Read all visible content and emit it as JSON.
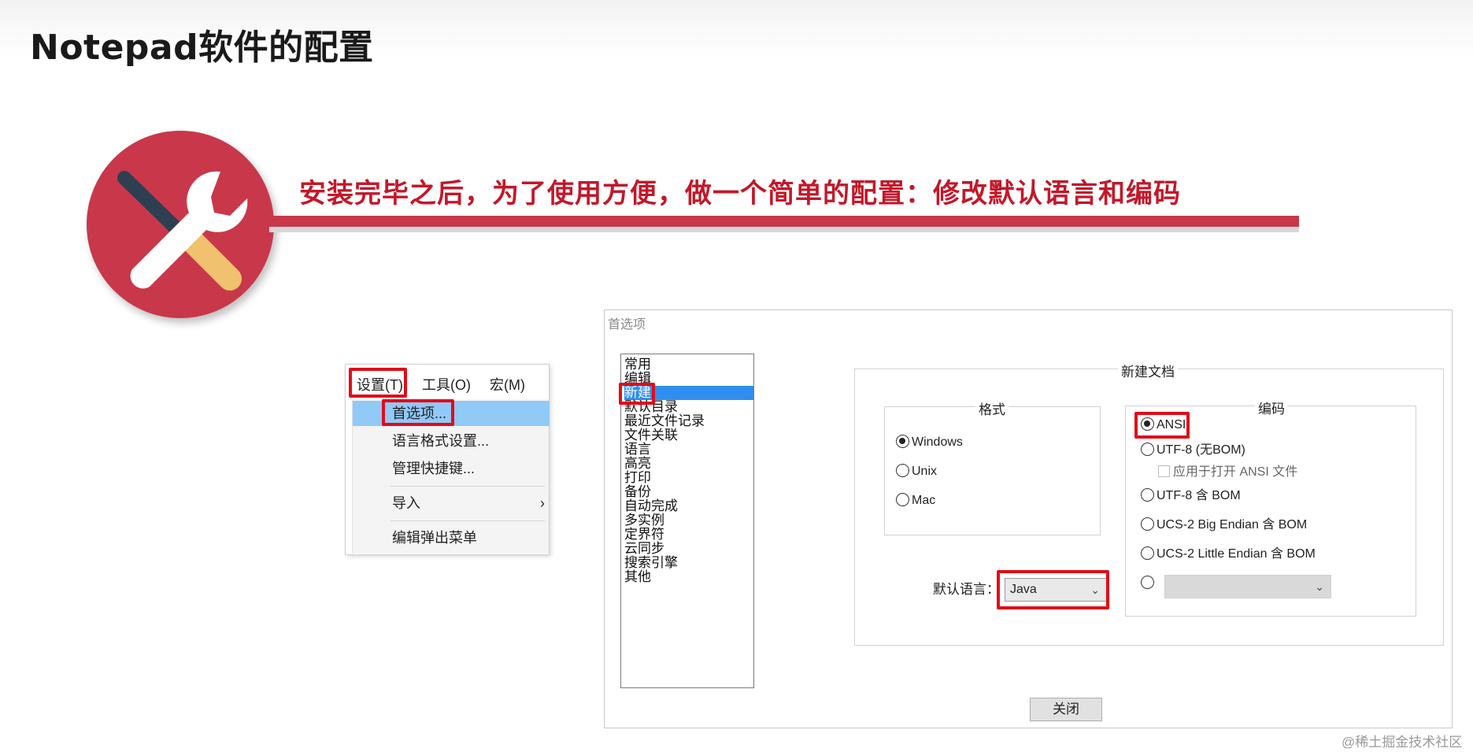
{
  "slide": {
    "title": "Notepad软件的配置",
    "headline": "安装完毕之后，为了使用方便，做一个简单的配置：修改默认语言和编码",
    "watermark": "@稀土掘金技术社区"
  },
  "colors": {
    "accent": "#c8384a",
    "highlight_box": "#e10b19",
    "selection": "#2f8ff0",
    "menu_highlight": "#91c9f7"
  },
  "menu": {
    "bar": [
      "设置(T)",
      "工具(O)",
      "宏(M)"
    ],
    "items": [
      "首选项...",
      "语言格式设置...",
      "管理快捷键...",
      "导入",
      "编辑弹出菜单"
    ]
  },
  "dialog": {
    "title": "首选项",
    "categories": [
      "常用",
      "编辑",
      "新建",
      "默认目录",
      "最近文件记录",
      "文件关联",
      "语言",
      "高亮",
      "打印",
      "备份",
      "自动完成",
      "多实例",
      "定界符",
      "云同步",
      "搜索引擎",
      "其他"
    ],
    "selected_category": "新建",
    "new_doc_label": "新建文档",
    "format": {
      "label": "格式",
      "options": [
        "Windows",
        "Unix",
        "Mac"
      ],
      "selected": "Windows"
    },
    "encoding": {
      "label": "编码",
      "options": [
        "ANSI",
        "UTF-8 (无BOM)",
        "UTF-8 含 BOM",
        "UCS-2 Big Endian 含 BOM",
        "UCS-2 Little Endian 含 BOM"
      ],
      "selected": "ANSI",
      "apply_ansi": "应用于打开 ANSI 文件"
    },
    "default_language_label": "默认语言：",
    "default_language_value": "Java",
    "close_label": "关闭"
  }
}
